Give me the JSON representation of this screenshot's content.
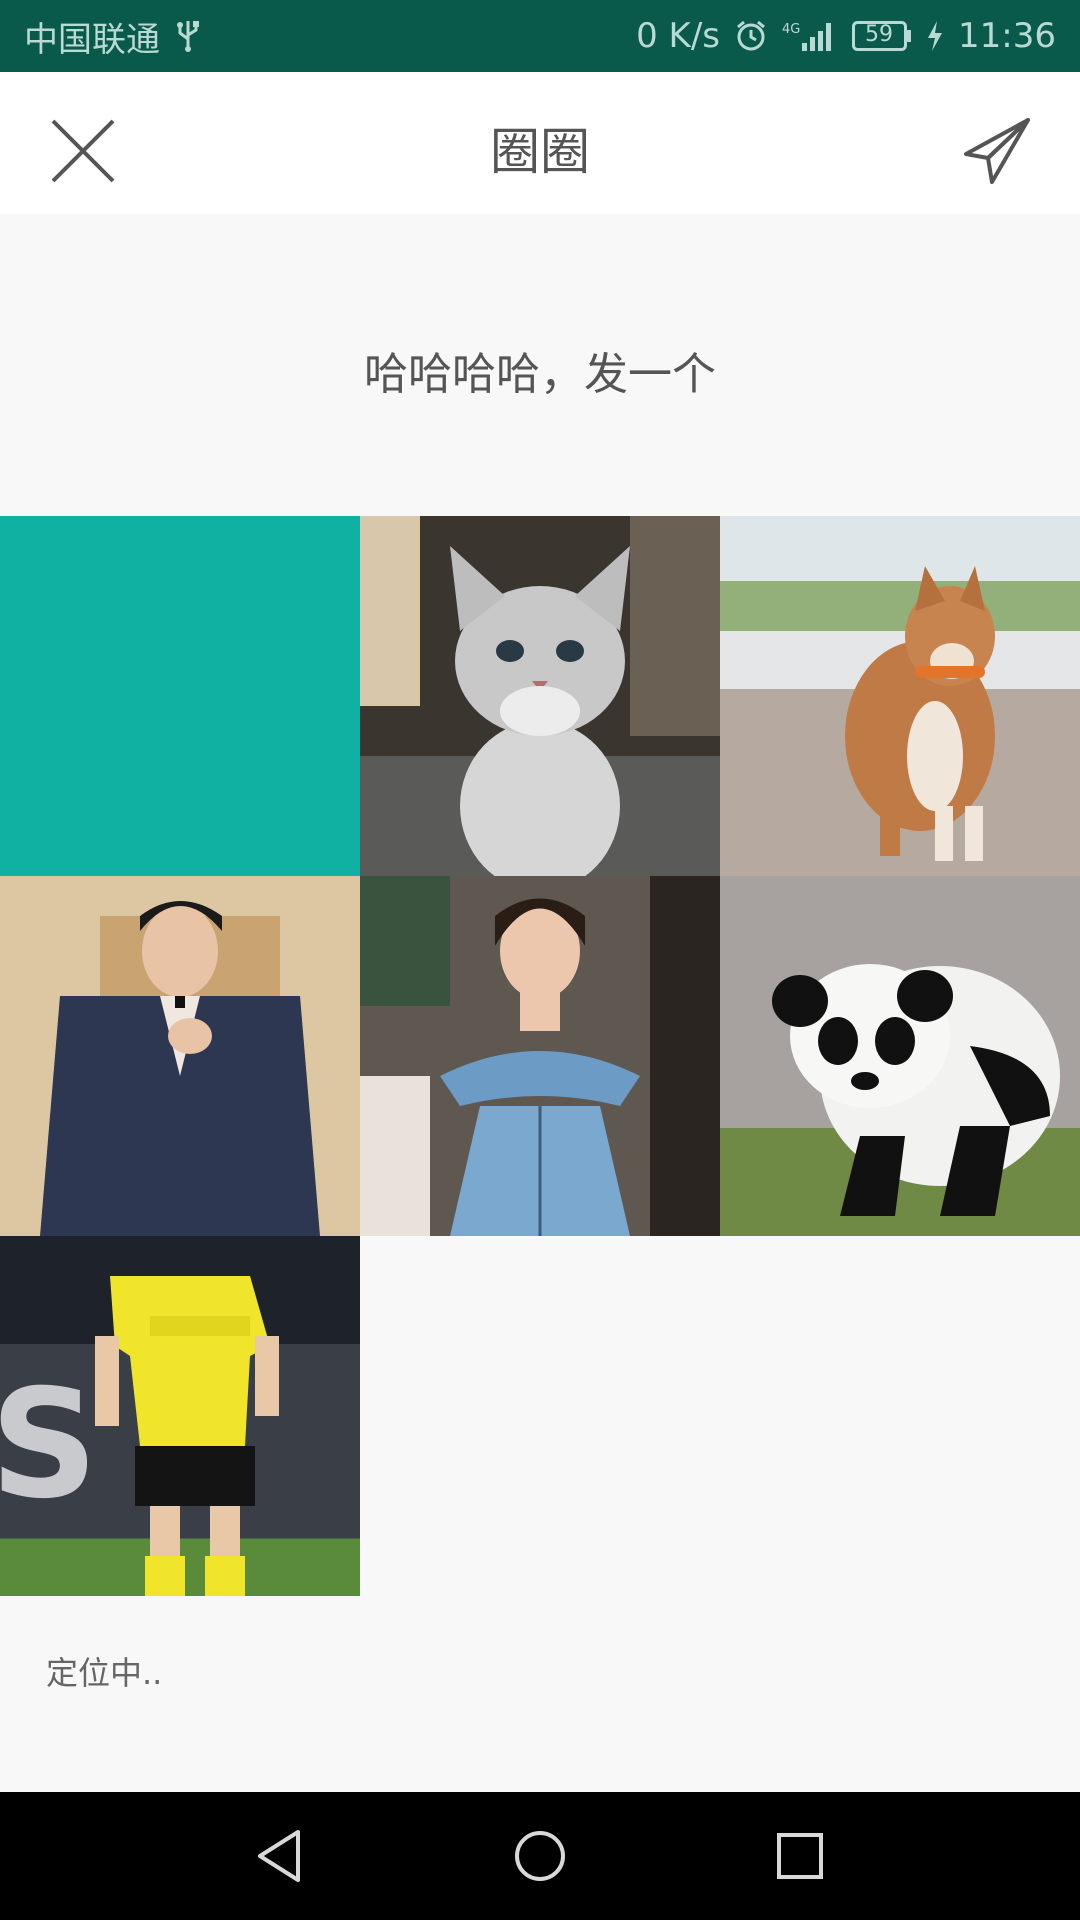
{
  "status_bar": {
    "carrier": "中国联通",
    "network_speed": "0 K/s",
    "network_type": "4G",
    "battery": "59",
    "time": "11:36",
    "bg_color": "#0a5a4b"
  },
  "header": {
    "title": "圈圈",
    "close_icon": "close-icon",
    "send_icon": "paper-plane-icon"
  },
  "post": {
    "text": "哈哈哈哈，发一个"
  },
  "images": [
    {
      "name": "teal-placeholder",
      "color": "#10b0a2"
    },
    {
      "name": "kitten"
    },
    {
      "name": "shiba-dog"
    },
    {
      "name": "man-in-suit"
    },
    {
      "name": "woman-in-denim-dress"
    },
    {
      "name": "panda"
    },
    {
      "name": "football-player"
    }
  ],
  "location": {
    "label": "定位中.."
  },
  "nav_bar": {
    "back_icon": "back-triangle-icon",
    "home_icon": "home-circle-icon",
    "recents_icon": "recents-square-icon"
  }
}
